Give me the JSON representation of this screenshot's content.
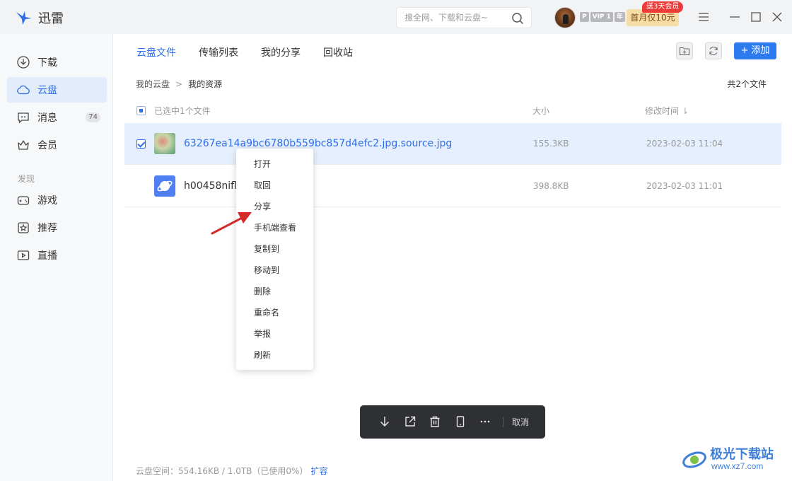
{
  "app": {
    "name": "迅雷",
    "search_placeholder": "搜全网、下载和云盘~",
    "vip_badges": [
      "P",
      "VIP 1",
      "年"
    ],
    "promo_label": "首月仅10元",
    "promo_tag": "送3天会员",
    "icons": [
      "menu-icon",
      "minimize-icon",
      "maximize-icon",
      "close-icon"
    ]
  },
  "sidebar": {
    "items": [
      {
        "label": "下载",
        "icon": "download-icon"
      },
      {
        "label": "云盘",
        "icon": "cloud-icon",
        "active": true
      },
      {
        "label": "消息",
        "icon": "message-icon",
        "count": "74"
      },
      {
        "label": "会员",
        "icon": "crown-icon"
      }
    ],
    "section_label": "发现",
    "discover_items": [
      {
        "label": "游戏",
        "icon": "gamepad-icon"
      },
      {
        "label": "推荐",
        "icon": "star-icon"
      },
      {
        "label": "直播",
        "icon": "live-icon"
      }
    ]
  },
  "main": {
    "tabs": [
      {
        "label": "云盘文件",
        "active": true
      },
      {
        "label": "传输列表"
      },
      {
        "label": "我的分享"
      },
      {
        "label": "回收站"
      }
    ],
    "add_label": "+ 添加",
    "breadcrumb": {
      "root": "我的云盘",
      "separator": ">",
      "current": "我的资源"
    },
    "file_count": "共2个文件",
    "header": {
      "selected": "已选中1个文件",
      "size": "大小",
      "date": "修改时间 ⇂"
    },
    "files": [
      {
        "name": "63267ea14a9bc6780b559bc857d4efc2.jpg.source.jpg",
        "size": "155.3KB",
        "date": "2023-02-03 11:04",
        "selected": true
      },
      {
        "name": "h00458nifli.l",
        "size": "398.8KB",
        "date": "2023-02-03 11:01",
        "selected": false
      }
    ]
  },
  "context_menu": [
    "打开",
    "取回",
    "分享",
    "手机端查看",
    "复制到",
    "移动到",
    "删除",
    "重命名",
    "举报",
    "刷新"
  ],
  "action_bar": {
    "cancel": "取消"
  },
  "footer": {
    "storage": "云盘空间：554.16KB / 1.0TB（已使用0%）",
    "expand": "扩容"
  },
  "watermark": {
    "line1": "极光下载站",
    "line2": "www.xz7.com"
  },
  "colors": {
    "accent": "#2e6ee8",
    "sidebar_bg": "#f7f8fa",
    "selected_row": "#e6effd",
    "action_bar": "#2f3034"
  }
}
